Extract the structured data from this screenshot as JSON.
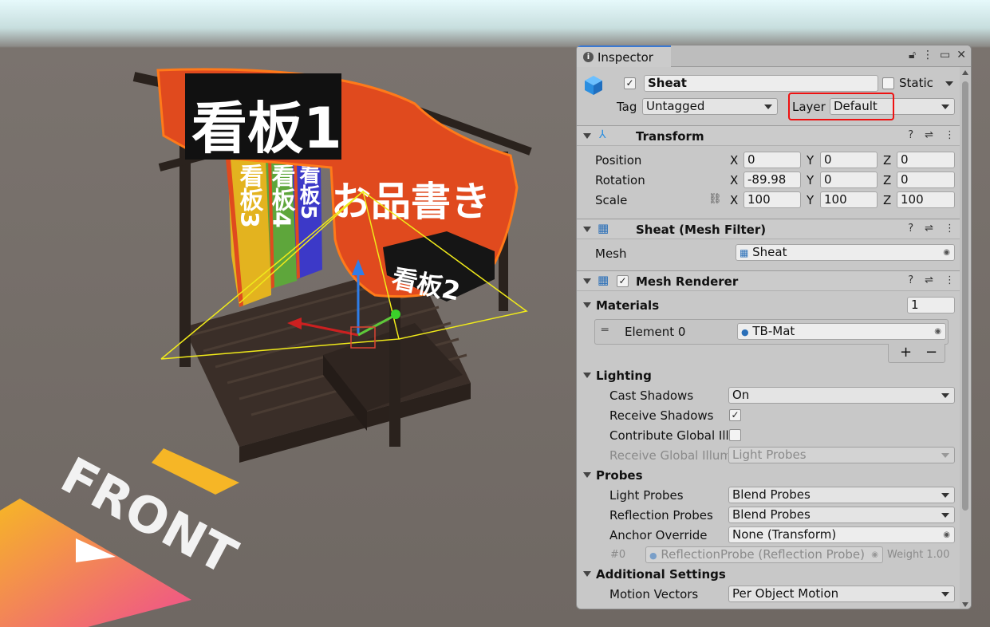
{
  "scene": {
    "sign1": "看板1",
    "sign_board2": "看板2",
    "banner": "お品書き",
    "flag3": "看板3",
    "flag4": "看板4",
    "flag5": "看板5",
    "gizmo_label": "FRONT"
  },
  "inspector": {
    "tab_label": "Inspector",
    "object_name": "Sheat",
    "active_checked": true,
    "static_label": "Static",
    "tag_label": "Tag",
    "tag_value": "Untagged",
    "layer_label": "Layer",
    "layer_value": "Default",
    "transform": {
      "title": "Transform",
      "position_label": "Position",
      "rotation_label": "Rotation",
      "scale_label": "Scale",
      "position": {
        "x": "0",
        "y": "0",
        "z": "0"
      },
      "rotation": {
        "x": "-89.98",
        "y": "0",
        "z": "0"
      },
      "scale": {
        "x": "100",
        "y": "100",
        "z": "100"
      },
      "axis_x": "X",
      "axis_y": "Y",
      "axis_z": "Z"
    },
    "mesh_filter": {
      "title": "Sheat (Mesh Filter)",
      "mesh_label": "Mesh",
      "mesh_value": "Sheat"
    },
    "mesh_renderer": {
      "title": "Mesh Renderer",
      "materials_label": "Materials",
      "materials_count": "1",
      "element0_label": "Element 0",
      "element0_value": "TB-Mat",
      "plus": "+",
      "minus": "−",
      "lighting_label": "Lighting",
      "cast_shadows_label": "Cast Shadows",
      "cast_shadows_value": "On",
      "receive_shadows_label": "Receive Shadows",
      "contribute_gi_label": "Contribute Global Illu",
      "receive_gi_label": "Receive Global Illum",
      "receive_gi_value": "Light Probes",
      "probes_label": "Probes",
      "light_probes_label": "Light Probes",
      "light_probes_value": "Blend Probes",
      "reflection_probes_label": "Reflection Probes",
      "reflection_probes_value": "Blend Probes",
      "anchor_override_label": "Anchor Override",
      "anchor_override_value": "None (Transform)",
      "probe0_index": "#0",
      "probe0_value": "ReflectionProbe (Reflection Probe)",
      "probe0_weight": "Weight 1.00",
      "additional_label": "Additional Settings",
      "motion_vectors_label": "Motion Vectors",
      "motion_vectors_value": "Per Object Motion"
    }
  },
  "colors": {
    "highlight": "#e11111",
    "banner_red": "#e04a1e",
    "accent_blue": "#3a79d3"
  }
}
